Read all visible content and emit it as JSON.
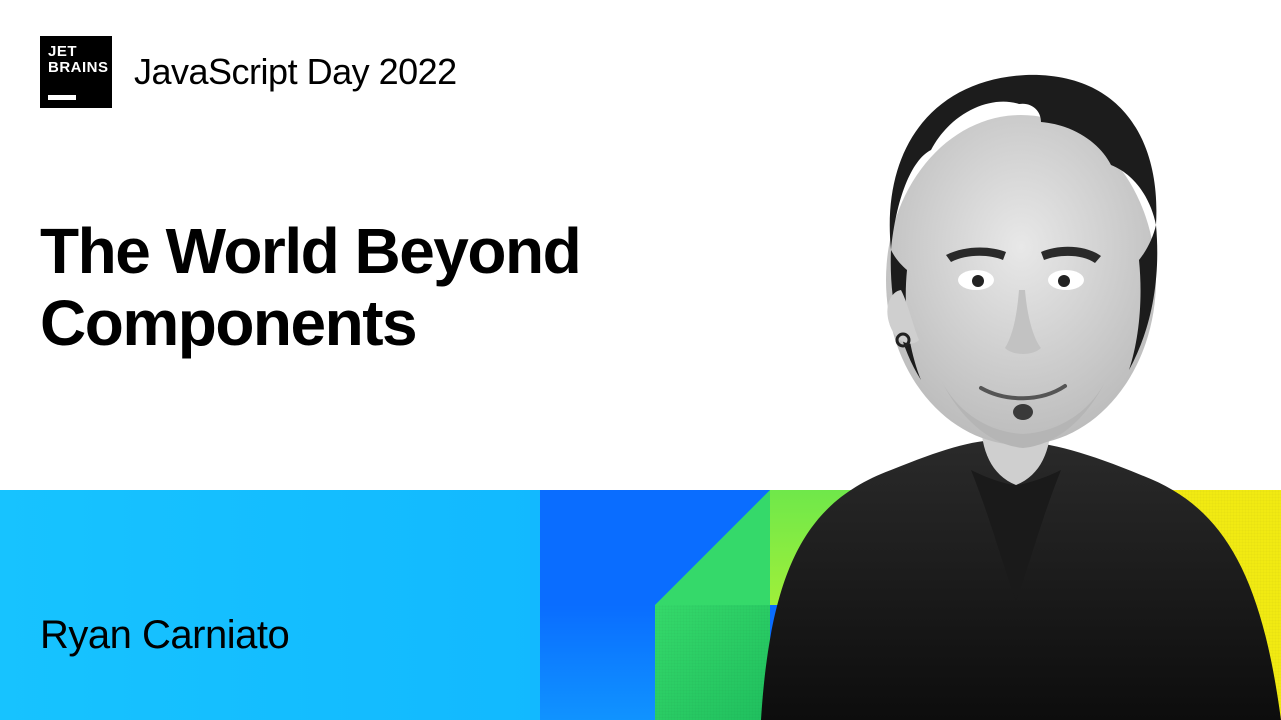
{
  "logo": {
    "line1": "JET",
    "line2": "BRAINS"
  },
  "event_name": "JavaScript Day 2022",
  "talk_title": "The World Beyond Components",
  "speaker_name": "Ryan Carniato"
}
